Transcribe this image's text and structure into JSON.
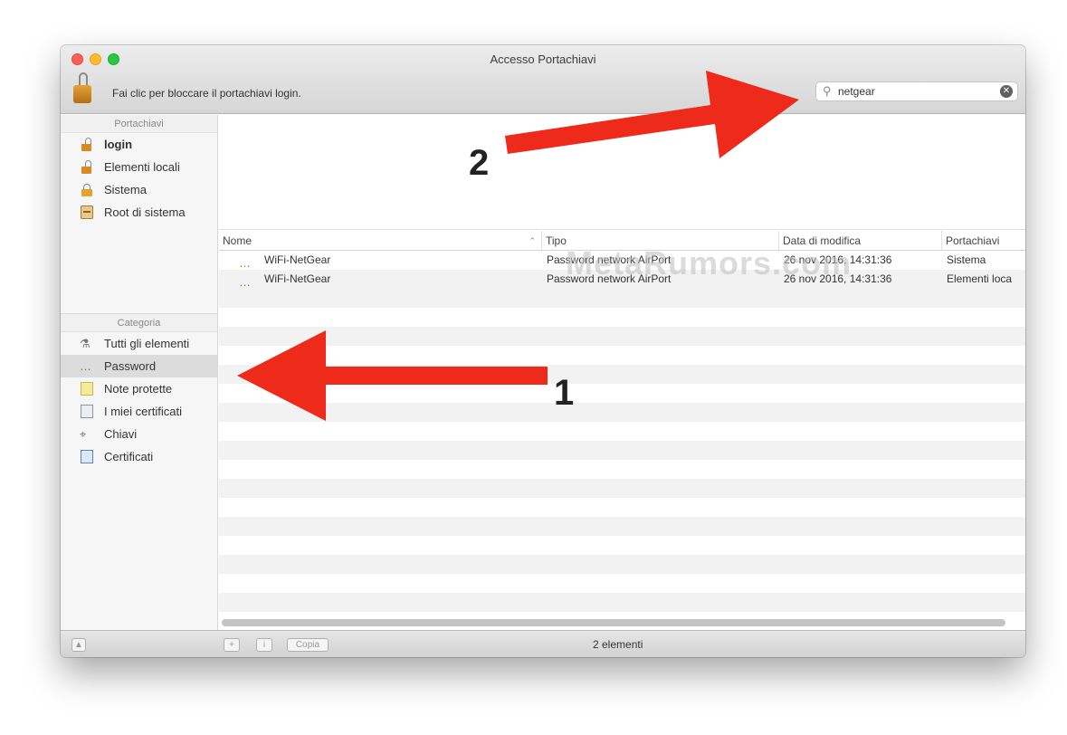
{
  "window": {
    "title": "Accesso Portachiavi",
    "lock_hint": "Fai clic per bloccare il portachiavi login."
  },
  "search": {
    "value": "netgear",
    "icon": "magnifier-icon",
    "clear_icon": "clear-x-icon"
  },
  "sidebar": {
    "keychains_header": "Portachiavi",
    "keychains": [
      {
        "label": "login",
        "icon": "unlocked-lock-icon"
      },
      {
        "label": "Elementi locali",
        "icon": "unlocked-lock-icon"
      },
      {
        "label": "Sistema",
        "icon": "lock-icon"
      },
      {
        "label": "Root di sistema",
        "icon": "cabinet-icon"
      }
    ],
    "categories_header": "Categoria",
    "categories": [
      {
        "label": "Tutti gli elementi",
        "icon": "all-items-icon"
      },
      {
        "label": "Password",
        "icon": "password-icon"
      },
      {
        "label": "Note protette",
        "icon": "secure-note-icon"
      },
      {
        "label": "I miei certificati",
        "icon": "my-certificate-icon"
      },
      {
        "label": "Chiavi",
        "icon": "key-icon"
      },
      {
        "label": "Certificati",
        "icon": "certificate-icon"
      }
    ],
    "selected_keychain": "login",
    "selected_category": "Password"
  },
  "table": {
    "columns": [
      "Nome",
      "Tipo",
      "Data di modifica",
      "Portachiavi"
    ],
    "rows": [
      {
        "name": "WiFi-NetGear",
        "type": "Password network AirPort",
        "modified": "26 nov 2016, 14:31:36",
        "keychain": "Sistema"
      },
      {
        "name": "WiFi-NetGear",
        "type": "Password network AirPort",
        "modified": "26 nov 2016, 14:31:36",
        "keychain": "Elementi loca"
      }
    ]
  },
  "footer": {
    "add_label": "+",
    "info_label": "i",
    "copy_label": "Copia",
    "status": "2 elementi"
  },
  "annotations": {
    "arrow1_label": "1",
    "arrow2_label": "2",
    "watermark": "MetaRumors.com",
    "arrow_color": "#ee2a1b"
  }
}
